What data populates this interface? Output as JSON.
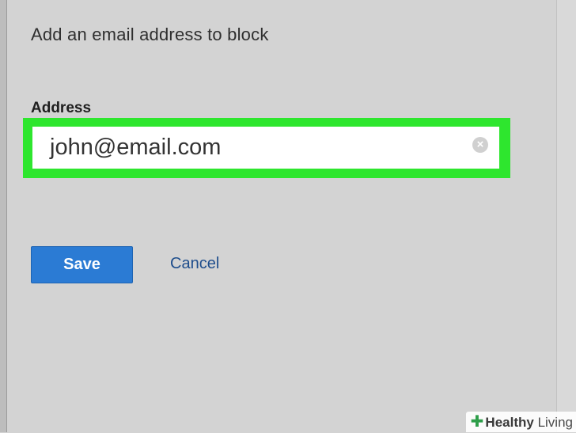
{
  "dialog": {
    "heading": "Add an email address to block",
    "address_label": "Address",
    "address_value": "john@email.com",
    "clear_icon": "clear-icon",
    "save_label": "Save",
    "cancel_label": "Cancel"
  },
  "watermark": {
    "bold": "Healthy",
    "regular": "Living",
    "icon": "plus-cross-icon"
  },
  "colors": {
    "background": "#d3d3d3",
    "highlight": "#2ee62e",
    "save_button": "#2b7bd4",
    "cancel_link": "#1e4d8c"
  }
}
